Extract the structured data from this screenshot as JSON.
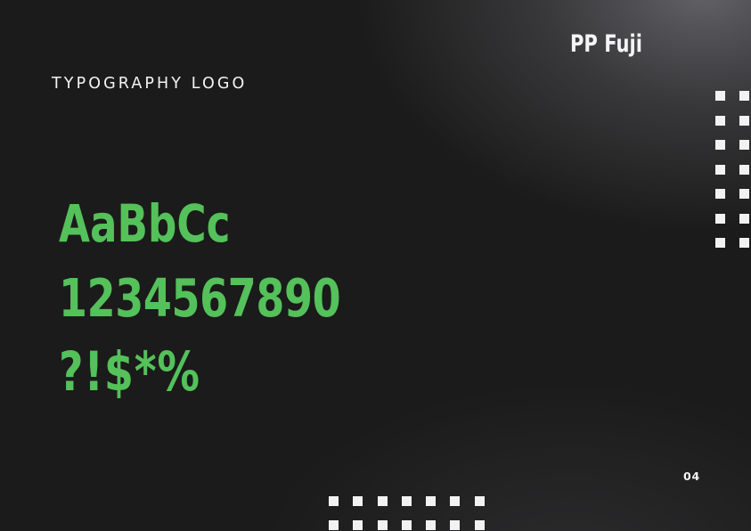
{
  "slide": {
    "heading": "TYPOGRAPHY LOGO",
    "font_name": "PP Fuji",
    "specimen": {
      "letters": "AaBbCc",
      "digits": "1234567890",
      "symbols": "?!$*%"
    },
    "page_number": "04"
  },
  "colors": {
    "background": "#1b1b1b",
    "text": "#f4f4f4",
    "accent_green": "#54c15a",
    "dots": "#f2f2f2"
  },
  "decorations": {
    "right_dot_grid": {
      "columns": 2,
      "rows": 7
    },
    "bottom_dot_grid": {
      "columns": 7,
      "rows": 2
    }
  }
}
